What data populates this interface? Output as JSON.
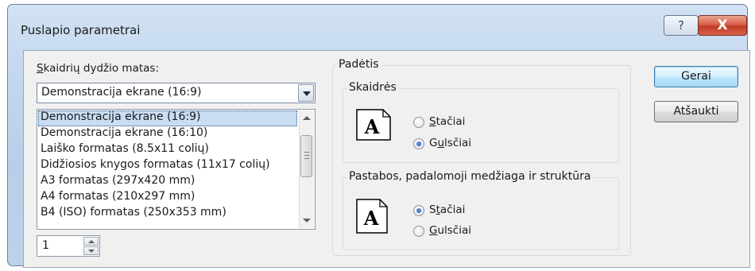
{
  "window": {
    "title": "Puslapio parametrai",
    "help_glyph": "?",
    "close_glyph": "X"
  },
  "slide_size": {
    "label_prefix": "",
    "label_underlined": "S",
    "label_rest": "kaidrių dydžio matas:",
    "selected_value": "Demonstracija ekrane (16:9)",
    "options": [
      "Demonstracija ekrane (16:9)",
      "Demonstracija ekrane (16:10)",
      "Laiško formatas (8.5x11 colių)",
      "Didžiosios knygos formatas (11x17 colių)",
      "A3 formatas (297x420 mm)",
      "A4 formatas (210x297 mm)",
      "B4 (ISO) formatas (250x353 mm)"
    ],
    "selected_index": 0,
    "number_value": "1"
  },
  "orientation": {
    "title": "Padėtis",
    "slides": {
      "title": "Skaidrės",
      "portrait": {
        "underlined": "S",
        "rest": "tačiai",
        "checked": false
      },
      "landscape": {
        "prefix": "G",
        "underlined": "u",
        "rest": "lsčiai",
        "checked": true
      }
    },
    "notes": {
      "title": "Pastabos, padalomoji medžiaga ir struktūra",
      "portrait": {
        "prefix": "S",
        "underlined": "t",
        "rest": "ačiai",
        "checked": true
      },
      "landscape": {
        "prefix": "",
        "underlined": "G",
        "rest": "ulsčiai",
        "checked": false
      }
    },
    "icon_glyph": "A"
  },
  "buttons": {
    "ok": "Gerai",
    "cancel": "Atšaukti"
  },
  "colors": {
    "selection": "#c9ddf3",
    "close_red": "#c13d26",
    "radio_fill": "#1c4f9e"
  }
}
